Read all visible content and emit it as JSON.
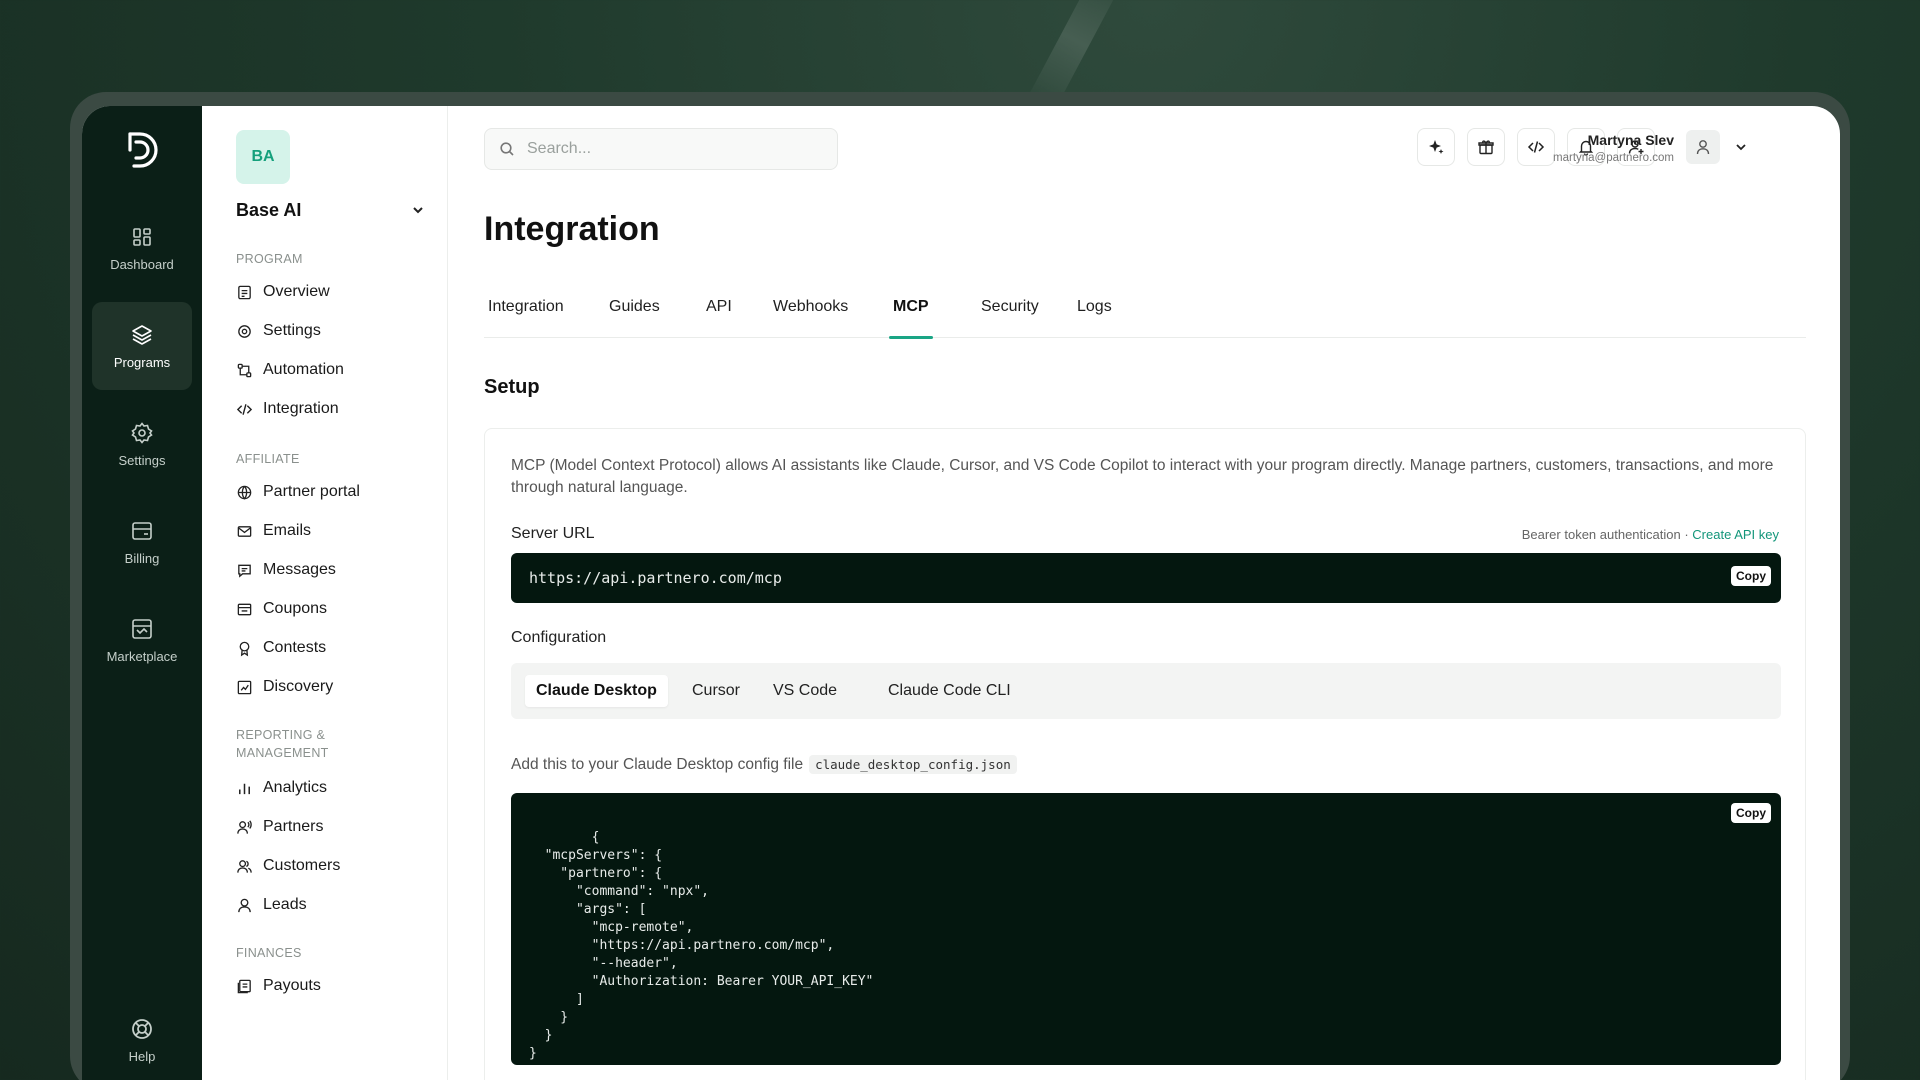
{
  "rail": {
    "items": [
      {
        "label": "Dashboard",
        "icon": "grid-icon"
      },
      {
        "label": "Programs",
        "icon": "layers-icon"
      },
      {
        "label": "Settings",
        "icon": "gear-icon"
      },
      {
        "label": "Billing",
        "icon": "billing-icon"
      },
      {
        "label": "Marketplace",
        "icon": "store-icon"
      }
    ],
    "help_label": "Help",
    "active": "Programs"
  },
  "sidebar": {
    "org_initials": "BA",
    "org_name": "Base AI",
    "sections": [
      {
        "label": "PROGRAM",
        "items": [
          "Overview",
          "Settings",
          "Automation",
          "Integration"
        ]
      },
      {
        "label": "AFFILIATE",
        "items": [
          "Partner portal",
          "Emails",
          "Messages",
          "Coupons",
          "Contests",
          "Discovery"
        ]
      },
      {
        "label": "REPORTING & MANAGEMENT",
        "items": [
          "Analytics",
          "Partners",
          "Customers",
          "Leads"
        ]
      },
      {
        "label": "FINANCES",
        "items": [
          "Payouts"
        ]
      }
    ]
  },
  "header": {
    "search_placeholder": "Search...",
    "user_name": "Martyna Slev",
    "user_email": "martyna@partnero.com"
  },
  "page": {
    "title": "Integration",
    "tabs": [
      "Integration",
      "Guides",
      "API",
      "Webhooks",
      "MCP",
      "Security",
      "Logs"
    ],
    "active_tab": "MCP",
    "section_title": "Setup",
    "description": "MCP (Model Context Protocol) allows AI assistants like Claude, Cursor, and VS Code Copilot to interact with your program directly. Manage partners, customers, transactions, and more through natural language.",
    "server_url_label": "Server URL",
    "auth_note": "Bearer token authentication · ",
    "auth_link": "Create API key",
    "server_url": "https://api.partnero.com/mcp",
    "copy_label": "Copy",
    "configuration_label": "Configuration",
    "config_tabs": [
      "Claude Desktop",
      "Cursor",
      "VS Code",
      "Claude Code CLI"
    ],
    "active_config_tab": "Claude Desktop",
    "hint_text": "Add this to your Claude Desktop config file",
    "hint_file": "claude_desktop_config.json",
    "config_code": "{\n  \"mcpServers\": {\n    \"partnero\": {\n      \"command\": \"npx\",\n      \"args\": [\n        \"mcp-remote\",\n        \"https://api.partnero.com/mcp\",\n        \"--header\",\n        \"Authorization: Bearer YOUR_API_KEY\"\n      ]\n    }\n  }\n}"
  },
  "colors": {
    "accent": "#1aa585",
    "rail_bg": "#0b1f17",
    "code_bg": "#04170f"
  }
}
